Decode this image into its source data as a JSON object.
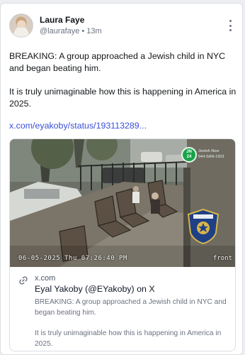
{
  "post": {
    "author_name": "Laura Faye",
    "author_handle": "@laurafaye",
    "separator": "•",
    "time": "13m",
    "paragraphs": [
      "BREAKING: A group approached a Jewish child in NYC and began beating him.",
      "It is truly unimaginable how this is happening in America in 2025."
    ],
    "link_text": "x.com/eyakoby/status/193113289..."
  },
  "embed": {
    "video": {
      "timestamp": "06-05-2025 Thu 07:26:40 PM",
      "camera_label": "front",
      "jn_badge_top": "JN",
      "jn_badge_bottom": "24",
      "jn_caption_line1": "Jewish Now",
      "jn_caption_line2": "544-SAN-1503"
    },
    "domain": "x.com",
    "title": "Eyal Yakoby (@EYakoby) on X",
    "description": [
      "BREAKING: A group approached a Jewish child in NYC and began beating him.",
      "It is truly unimaginable how this is happening in America in 2025."
    ]
  },
  "icons": {
    "more": "more-vertical-icon",
    "link": "link-icon"
  },
  "colors": {
    "link": "#3b4fd8",
    "card_border": "#dcdfe4",
    "muted_text": "#6b7280"
  }
}
